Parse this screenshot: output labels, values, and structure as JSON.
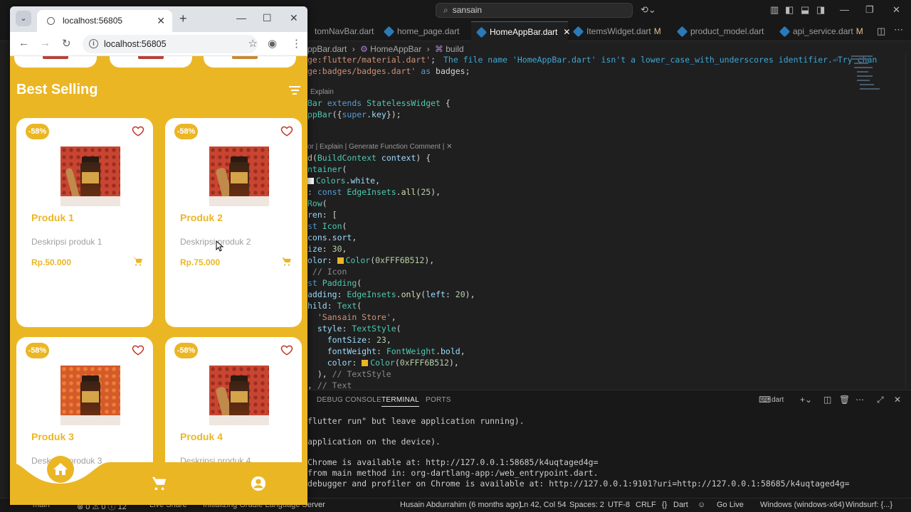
{
  "vscode": {
    "search_text": "sansain",
    "tabs": [
      {
        "label": "tomNavBar.dart",
        "modified": ""
      },
      {
        "label": "home_page.dart",
        "modified": ""
      },
      {
        "label": "HomeAppBar.dart",
        "modified": "",
        "close": "✕"
      },
      {
        "label": "ItemsWidget.dart",
        "modified": "M"
      },
      {
        "label": "product_model.dart",
        "modified": ""
      },
      {
        "label": "api_service.dart",
        "modified": "M"
      }
    ],
    "breadcrumb": {
      "part1": "ppBar.dart",
      "part2": "HomeAppBar",
      "part3": "build"
    },
    "warning": "The file name 'HomeAppBar.dart' isn't a lower_case_with_underscores identifier.⏎Try chan",
    "code_hint_1": "Explain",
    "code_hint_2": "or | Explain | Generate Function Comment | ✕",
    "color_swatches": {
      "white": "#ffffff",
      "gold": "#ebb624"
    },
    "panel_tabs": [
      "DEBUG CONSOLE",
      "TERMINAL",
      "PORTS"
    ],
    "panel_shell": "dart",
    "terminal_lines": [
      "flutter run\" but leave application running).",
      "application on the device).",
      "Chrome is available at: http://127.0.0.1:58685/k4uqtaged4g=",
      "from main method in: org-dartlang-app:/web_entrypoint.dart.",
      "debugger and profiler on Chrome is available at: http://127.0.0.1:9101?uri=http://127.0.0.1:58685/k4uqtaged4g="
    ],
    "status": {
      "branch": "main*",
      "problems": "⊗ 0  ⚠ 0  ⓘ 12",
      "live_share": "Live Share",
      "gradle": "Initializing Gradle Language Server",
      "blame": "Husain Abdurrahim (6 months ago)",
      "position": "Ln 42, Col 54",
      "spaces": "Spaces: 2",
      "encoding": "UTF-8",
      "eol": "CRLF",
      "language": "Dart",
      "golive": "Go Live",
      "platform": "Windows (windows-x64)",
      "windsurf": "Windsurf: {...}"
    }
  },
  "browser": {
    "tab_title": "localhost:56805",
    "url": "localhost:56805"
  },
  "app": {
    "section_title": "Best Selling",
    "products": [
      {
        "discount": "-58%",
        "name": "Produk 1",
        "desc": "Deskripsi produk 1",
        "price": "Rp.50.000"
      },
      {
        "discount": "-58%",
        "name": "Produk 2",
        "desc": "Deskripsi produk 2",
        "price": "Rp.75.000"
      },
      {
        "discount": "-58%",
        "name": "Produk 3",
        "desc": "Deskripsi produk 3",
        "price": ""
      },
      {
        "discount": "-58%",
        "name": "Produk 4",
        "desc": "Deskripsi produk 4",
        "price": ""
      }
    ],
    "accent_color": "#ebb624"
  }
}
